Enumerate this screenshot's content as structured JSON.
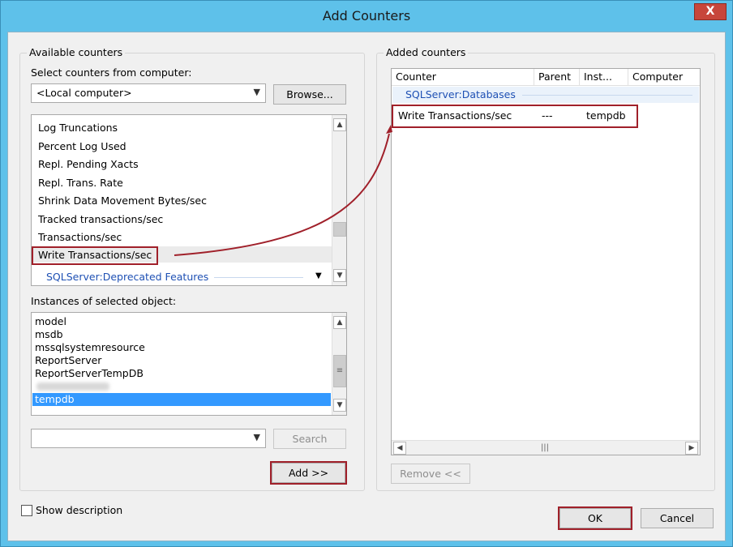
{
  "window": {
    "title": "Add Counters",
    "close_glyph": "X"
  },
  "available": {
    "group_label": "Available counters",
    "select_label": "Select counters from computer:",
    "computer_value": "<Local computer>",
    "browse_label": "Browse...",
    "counters": [
      "Log Truncations",
      "Percent Log Used",
      "Repl. Pending Xacts",
      "Repl. Trans. Rate",
      "Shrink Data Movement Bytes/sec",
      "Tracked transactions/sec",
      "Transactions/sec",
      "Write Transactions/sec"
    ],
    "next_object": "SQLServer:Deprecated Features",
    "instances_label": "Instances of selected object:",
    "instances": [
      "model",
      "msdb",
      "mssqlsystemresource",
      "ReportServer",
      "ReportServerTempDB",
      "",
      "tempdb"
    ],
    "search_value": "",
    "search_label": "Search",
    "add_label": "Add >>"
  },
  "added": {
    "group_label": "Added counters",
    "columns": [
      "Counter",
      "Parent",
      "Inst...",
      "Computer"
    ],
    "object_row": "SQLServer:Databases",
    "rows": [
      {
        "counter": "Write Transactions/sec",
        "parent": "---",
        "instance": "tempdb",
        "computer": ""
      }
    ],
    "remove_label": "Remove <<"
  },
  "footer": {
    "show_description_label": "Show description",
    "show_description_checked": false,
    "ok_label": "OK",
    "cancel_label": "Cancel"
  },
  "colors": {
    "title_bg": "#5ec1ea",
    "selection": "#3399ff",
    "highlight_outline": "#a0202a",
    "object_text": "#1e50b4"
  }
}
